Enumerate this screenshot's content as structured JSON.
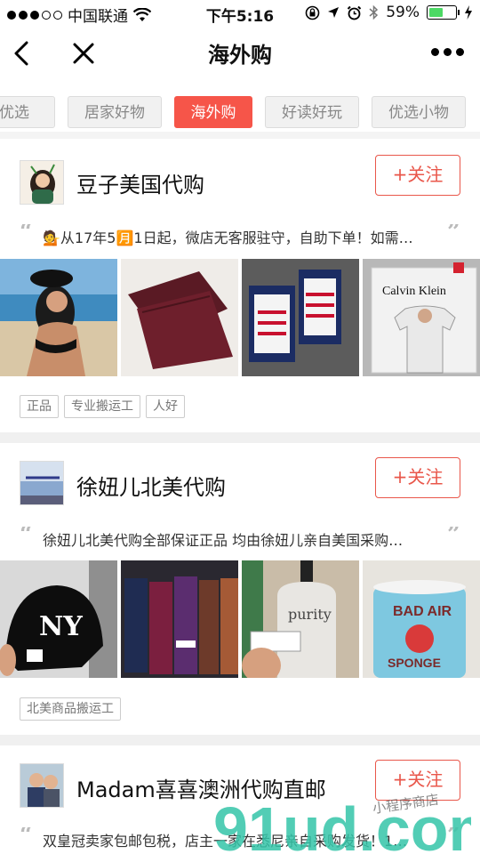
{
  "status_bar": {
    "carrier": "中国联通",
    "time": "下午5:16",
    "battery": "59%",
    "battery_level": 0.59,
    "battery_color": "#4cd964"
  },
  "nav": {
    "title": "海外购",
    "back_icon": "chevron-left-icon",
    "close_icon": "close-icon",
    "more_icon": "more-icon"
  },
  "tabs": [
    {
      "label": "优选",
      "active": false
    },
    {
      "label": "居家好物",
      "active": false
    },
    {
      "label": "海外购",
      "active": true
    },
    {
      "label": "好读好玩",
      "active": false
    },
    {
      "label": "优选小物",
      "active": false
    }
  ],
  "accent_color": "#f65549",
  "shops": [
    {
      "name": "豆子美国代购",
      "follow_label": "+关注",
      "intro": "💁从17年5🈷️1日起，微店无客服驻守，自助下单！如需…",
      "tags": [
        "正品",
        "专业搬运工",
        "人好"
      ]
    },
    {
      "name": "徐妞儿北美代购",
      "follow_label": "+关注",
      "intro": "徐妞儿北美代购全部保证正品 均由徐妞儿亲自美国采购…",
      "tags": [
        "北美商品搬运工"
      ]
    },
    {
      "name": "Madam喜喜澳洲代购直邮",
      "follow_label": "+关注",
      "intro": "双皇冠卖家包邮包税，店主一家在悉尼亲自采购发货！1…",
      "tags": []
    }
  ],
  "photo_texts": {
    "ck_brand": "Calvin Klein",
    "ny_logo": "NY",
    "purity": "purity",
    "bad_air": "BAD AIR",
    "sponge": "SPONGE"
  },
  "watermark": {
    "main": "91ud.com",
    "sub": "小程序商店"
  }
}
